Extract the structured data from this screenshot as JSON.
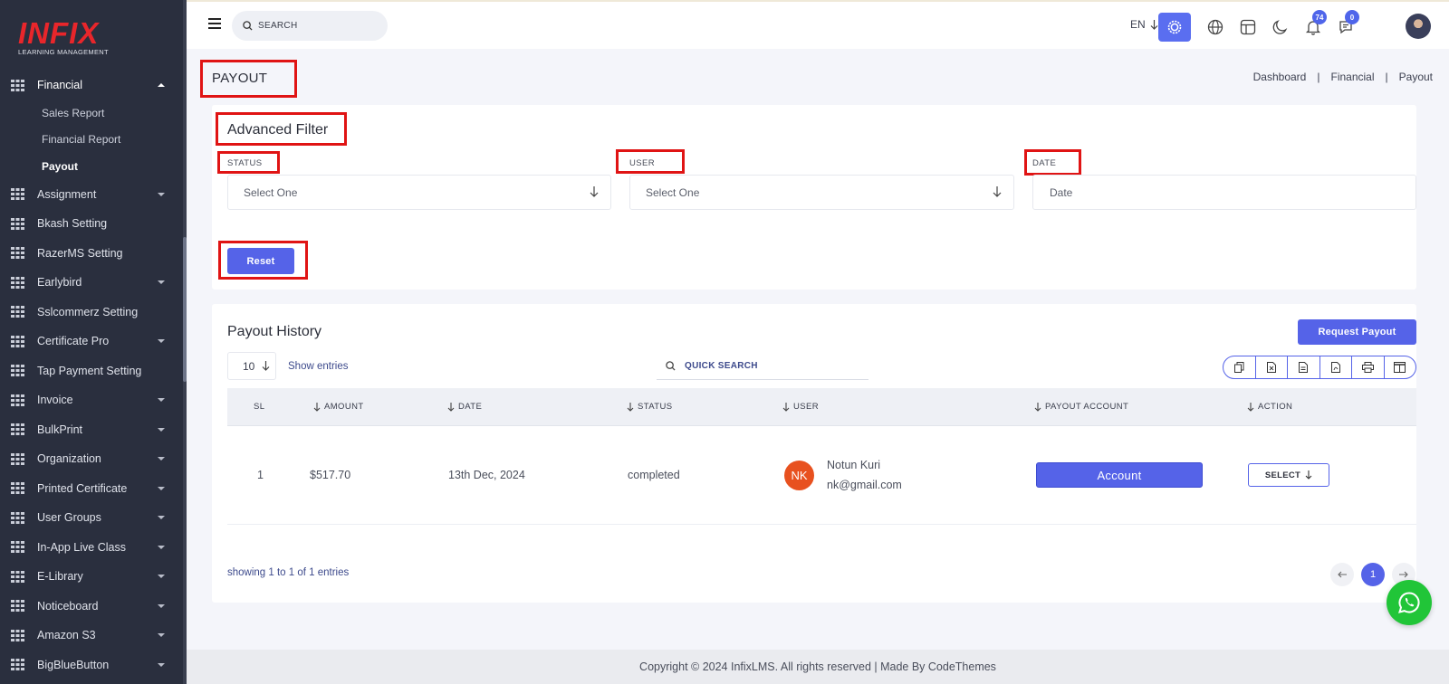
{
  "brand": {
    "name": "INFIX",
    "tagline": "LEARNING MANAGEMENT"
  },
  "sidebar": {
    "items": [
      {
        "label": "Financial",
        "expanded": true,
        "subitems": [
          {
            "label": "Sales Report"
          },
          {
            "label": "Financial Report"
          },
          {
            "label": "Payout",
            "active": true
          }
        ]
      },
      {
        "label": "Assignment",
        "has_caret": true
      },
      {
        "label": "Bkash Setting",
        "has_caret": false
      },
      {
        "label": "RazerMS Setting",
        "has_caret": false
      },
      {
        "label": "Earlybird",
        "has_caret": true
      },
      {
        "label": "Sslcommerz Setting",
        "has_caret": false
      },
      {
        "label": "Certificate Pro",
        "has_caret": true
      },
      {
        "label": "Tap Payment Setting",
        "has_caret": false
      },
      {
        "label": "Invoice",
        "has_caret": true
      },
      {
        "label": "BulkPrint",
        "has_caret": true
      },
      {
        "label": "Organization",
        "has_caret": true
      },
      {
        "label": "Printed Certificate",
        "has_caret": true
      },
      {
        "label": "User Groups",
        "has_caret": true
      },
      {
        "label": "In-App Live Class",
        "has_caret": true
      },
      {
        "label": "E-Library",
        "has_caret": true
      },
      {
        "label": "Noticeboard",
        "has_caret": true
      },
      {
        "label": "Amazon S3",
        "has_caret": true
      },
      {
        "label": "BigBlueButton",
        "has_caret": true
      }
    ]
  },
  "header": {
    "search_placeholder": "SEARCH",
    "language": "EN",
    "notifications_count": "74",
    "messages_count": "0"
  },
  "page": {
    "title": "PAYOUT",
    "breadcrumb": [
      "Dashboard",
      "Financial",
      "Payout"
    ]
  },
  "filter": {
    "title": "Advanced Filter",
    "status_label": "STATUS",
    "status_value": "Select One",
    "user_label": "USER",
    "user_value": "Select One",
    "date_label": "DATE",
    "date_placeholder": "Date",
    "reset_label": "Reset"
  },
  "history": {
    "title": "Payout History",
    "request_button": "Request Payout",
    "entries_value": "10",
    "show_entries": "Show entries",
    "quick_search": "QUICK SEARCH",
    "columns": [
      "SL",
      "AMOUNT",
      "DATE",
      "STATUS",
      "USER",
      "PAYOUT ACCOUNT",
      "ACTION"
    ],
    "rows": [
      {
        "sl": "1",
        "amount": "$517.70",
        "date": "13th Dec, 2024",
        "status": "completed",
        "user_initials": "NK",
        "user_name": "Notun Kuri",
        "user_email": "nk@gmail.com",
        "account_button": "Account",
        "action_button": "SELECT"
      }
    ],
    "showing": "showing 1 to 1 of 1 entries",
    "current_page": "1"
  },
  "footer": {
    "text": "Copyright © 2024 InfixLMS. All rights reserved | Made By CodeThemes"
  },
  "colors": {
    "accent": "#5563e8",
    "sidebar": "#2a2f3e",
    "highlight": "#e01414",
    "whatsapp": "#21c538"
  }
}
